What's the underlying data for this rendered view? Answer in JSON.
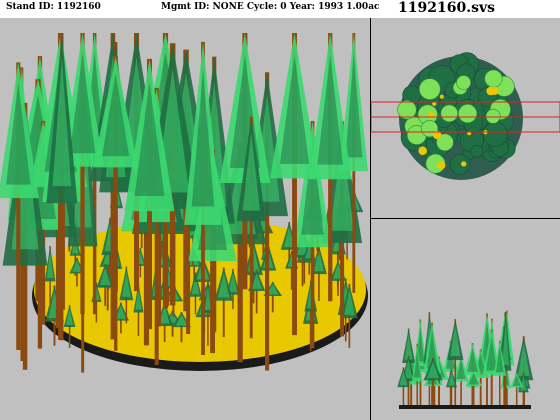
{
  "header": {
    "stand_id": "Stand ID: 1192160",
    "mgmt_info": "Mgmt ID: NONE Cycle: 0 Year: 1993 1.00ac",
    "file_name": "1192160.svs"
  },
  "views": {
    "main": "perspective-view",
    "plan": "overhead-plan-view",
    "side": "profile-view"
  },
  "colors": {
    "background": "#c0c0c0",
    "ground": "#e8c800",
    "ground_edge": "#1a1a1a",
    "trunk": "#8b4a10",
    "crown_light": "#3cd870",
    "crown_dark": "#1f6e44",
    "plan_disc": "#2f5e50",
    "plan_highlight": "#7fe05a",
    "selection_rect": "#e02020"
  },
  "icons": {
    "tree": "conifer-tree-icon",
    "stand": "stand-disc-icon"
  }
}
